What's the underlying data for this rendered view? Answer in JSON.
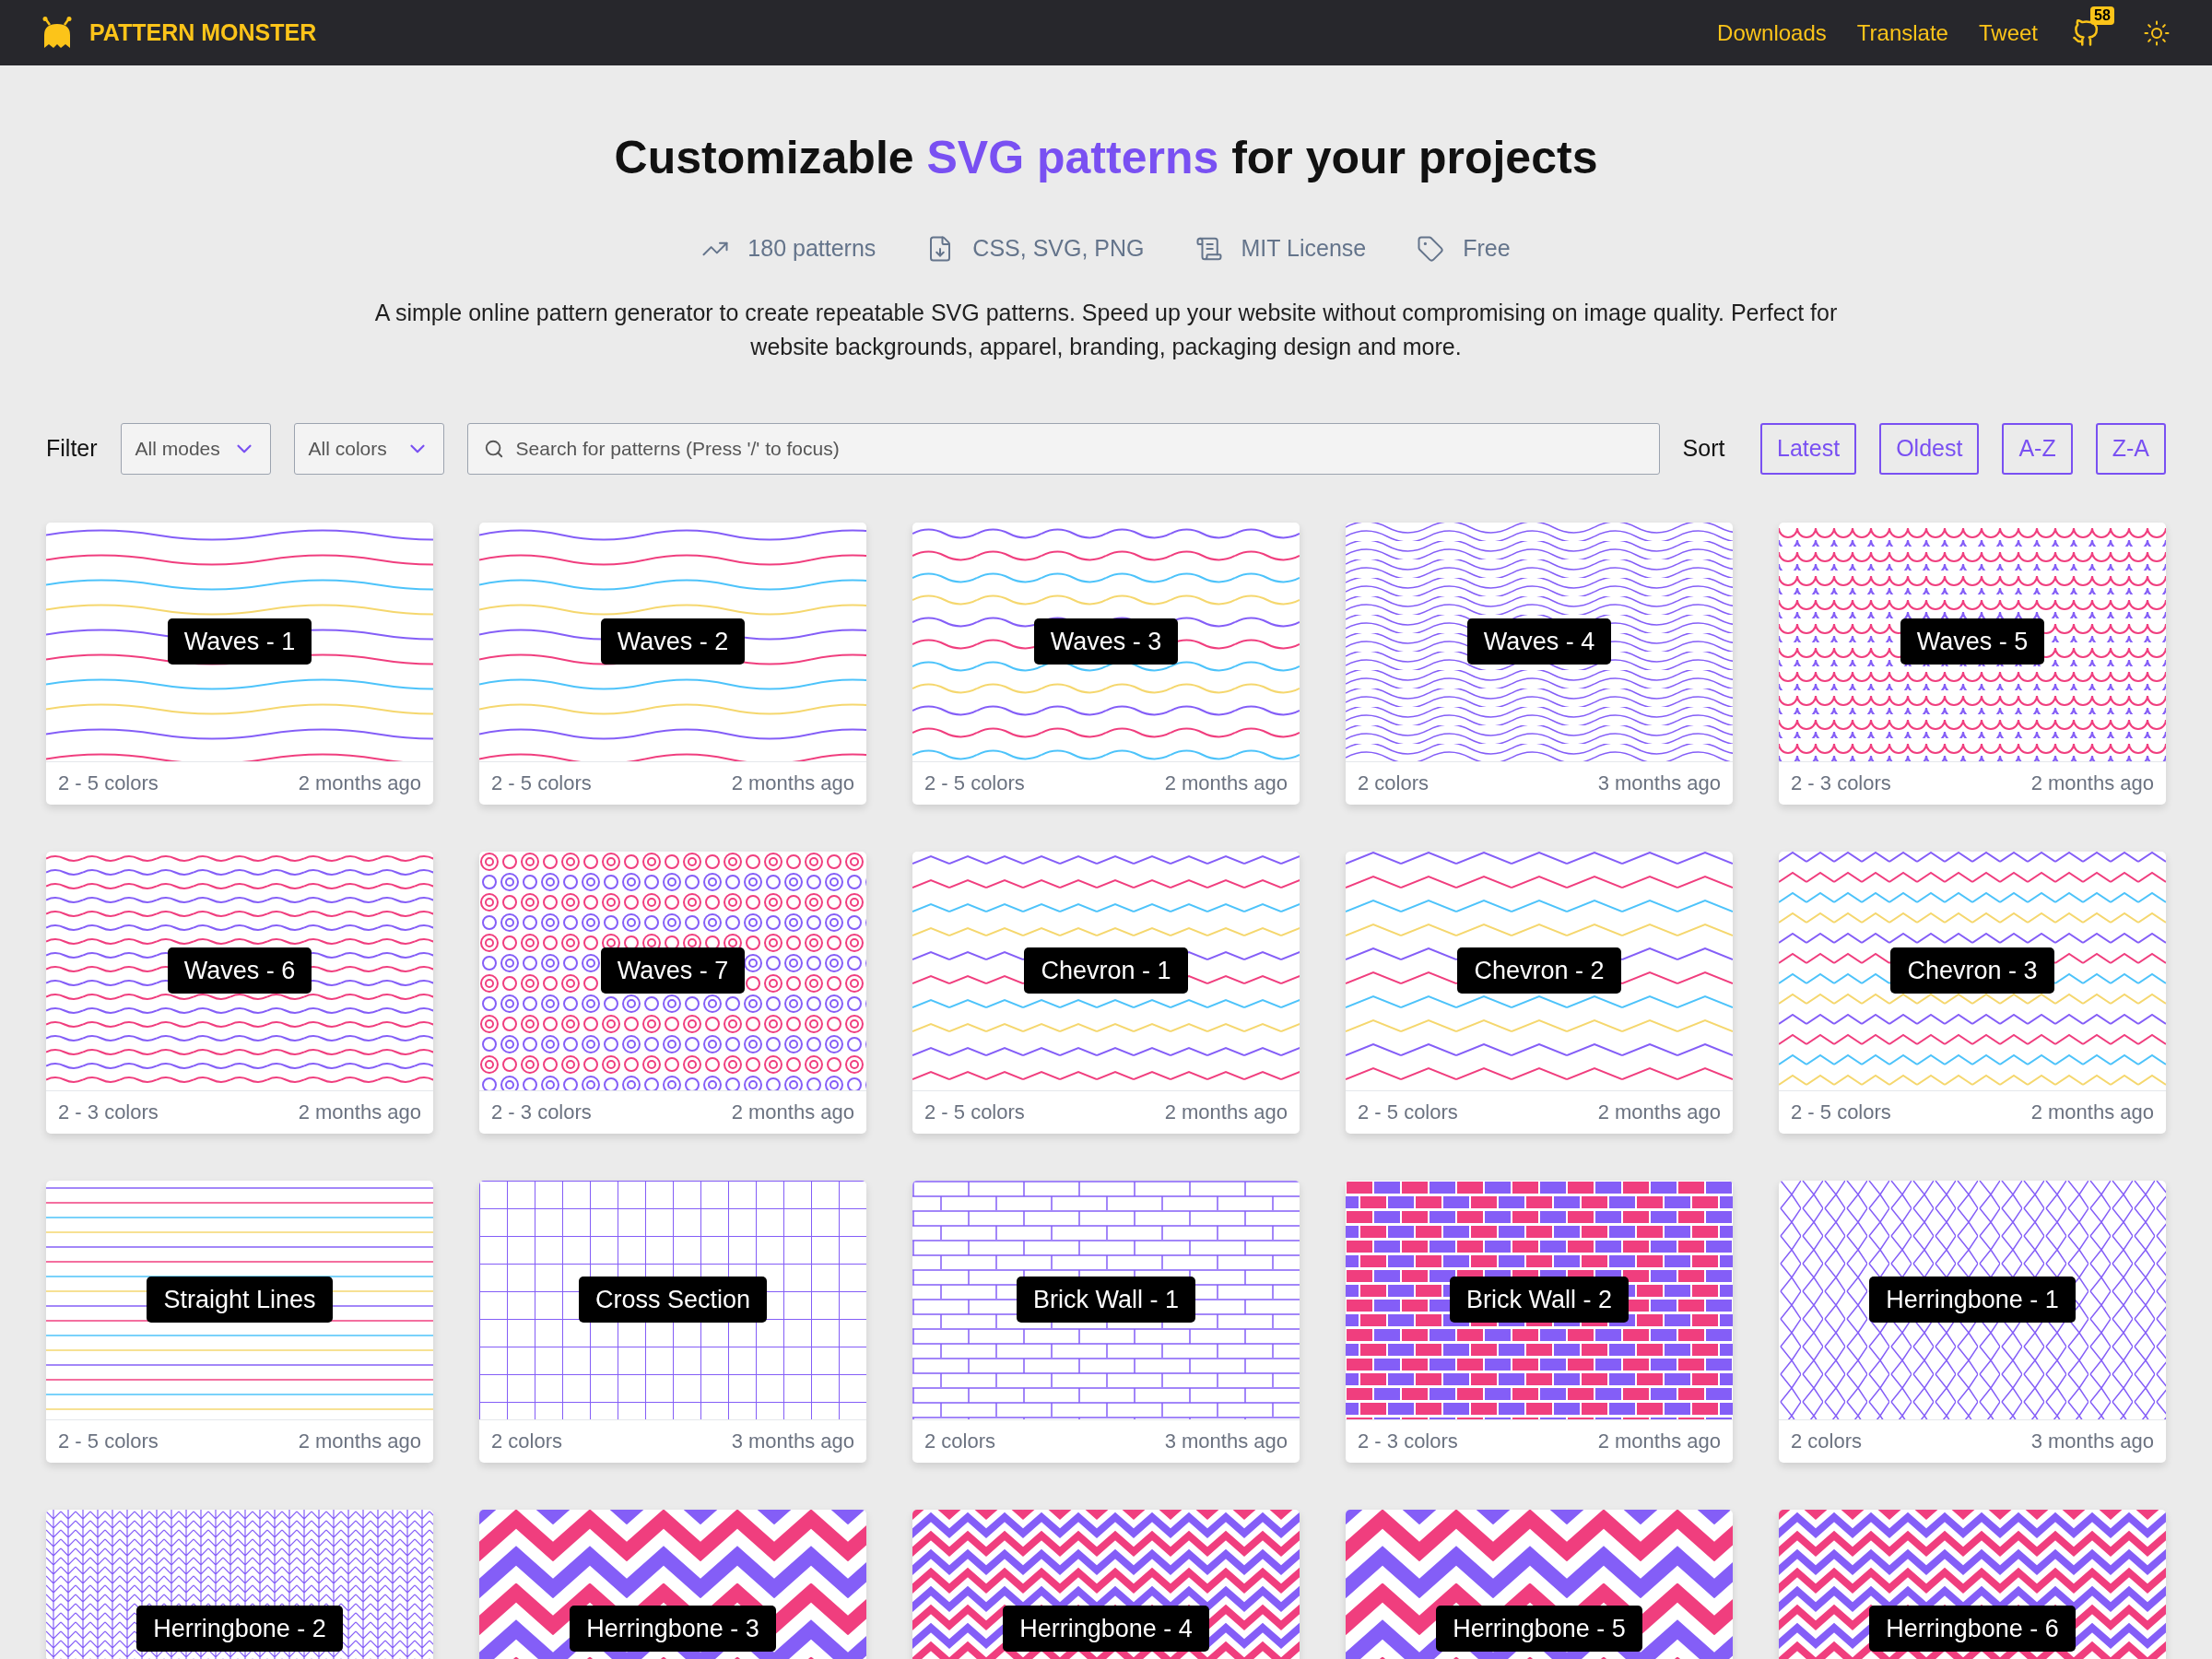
{
  "header": {
    "brand": "PATTERN MONSTER",
    "links": [
      "Downloads",
      "Translate",
      "Tweet"
    ],
    "stars_badge": "58"
  },
  "hero": {
    "title": {
      "before": "Customizable",
      "highlight": "SVG patterns",
      "after": "for your projects"
    },
    "stats": [
      {
        "kind": "trend",
        "label": "180 patterns"
      },
      {
        "kind": "file",
        "label": "CSS, SVG, PNG"
      },
      {
        "kind": "scroll",
        "label": "MIT License"
      },
      {
        "kind": "tag",
        "label": "Free"
      }
    ],
    "description": "A simple online pattern generator to create repeatable SVG patterns. Speed up your website without compromising on image quality. Perfect for website backgrounds, apparel, branding, packaging design and more."
  },
  "filter": {
    "label": "Filter",
    "modes": "All modes",
    "colors": "All colors",
    "search_placeholder": "Search for patterns (Press '/' to focus)"
  },
  "sort": {
    "label": "Sort",
    "options": [
      "Latest",
      "Oldest",
      "A-Z",
      "Z-A"
    ]
  },
  "patterns": [
    {
      "name": "Waves - 1",
      "kind": "waves",
      "colors": "2 - 5 colors",
      "age": "2 months ago"
    },
    {
      "name": "Waves - 2",
      "kind": "ripples",
      "colors": "2 - 5 colors",
      "age": "2 months ago"
    },
    {
      "name": "Waves - 3",
      "kind": "squiggles",
      "colors": "2 - 5 colors",
      "age": "2 months ago"
    },
    {
      "name": "Waves - 4",
      "kind": "contours",
      "colors": "2 colors",
      "age": "3 months ago"
    },
    {
      "name": "Waves - 5",
      "kind": "scallops",
      "colors": "2 - 3 colors",
      "age": "2 months ago"
    },
    {
      "name": "Waves - 6",
      "kind": "billows",
      "colors": "2 - 3 colors",
      "age": "2 months ago"
    },
    {
      "name": "Waves - 7",
      "kind": "spirals",
      "colors": "2 - 3 colors",
      "age": "2 months ago"
    },
    {
      "name": "Chevron - 1",
      "kind": "chevron",
      "colors": "2 - 5 colors",
      "age": "2 months ago"
    },
    {
      "name": "Chevron - 2",
      "kind": "zigzag",
      "colors": "2 - 5 colors",
      "age": "2 months ago"
    },
    {
      "name": "Chevron - 3",
      "kind": "sawtooth",
      "colors": "2 - 5 colors",
      "age": "2 months ago"
    },
    {
      "name": "Straight Lines",
      "kind": "lines",
      "colors": "2 - 5 colors",
      "age": "2 months ago"
    },
    {
      "name": "Cross Section",
      "kind": "grid",
      "colors": "2 colors",
      "age": "3 months ago"
    },
    {
      "name": "Brick Wall - 1",
      "kind": "brick",
      "colors": "2 colors",
      "age": "3 months ago"
    },
    {
      "name": "Brick Wall - 2",
      "kind": "masonry",
      "colors": "2 - 3 colors",
      "age": "2 months ago"
    },
    {
      "name": "Herringbone - 1",
      "kind": "herringbone",
      "colors": "2 colors",
      "age": "3 months ago"
    },
    {
      "name": "Herringbone - 2",
      "kind": "stitch"
    },
    {
      "name": "Herringbone - 3",
      "kind": "arrows"
    },
    {
      "name": "Herringbone - 4",
      "kind": "darts"
    },
    {
      "name": "Herringbone - 5",
      "kind": "arrows"
    },
    {
      "name": "Herringbone - 6",
      "kind": "darts"
    }
  ]
}
